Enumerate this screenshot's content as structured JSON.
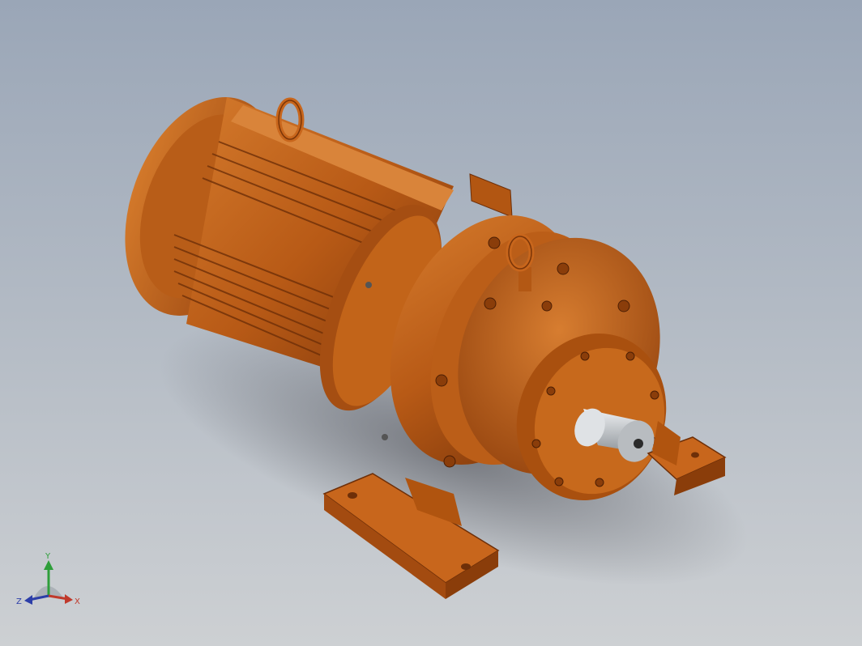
{
  "viewport": {
    "background_top": "#9aa6b7",
    "background_bottom": "#cdd0d3"
  },
  "model": {
    "description_icon": "gear-motor-3d-model",
    "body_color": "#c4661c",
    "body_dark": "#8a3e0a",
    "body_light": "#e08a3a",
    "shaft_color": "#c8ccd0"
  },
  "triad": {
    "x_label": "X",
    "y_label": "Y",
    "z_label": "Z",
    "x_color": "#c0392b",
    "y_color": "#2e9e3a",
    "z_color": "#2c3ea8"
  }
}
